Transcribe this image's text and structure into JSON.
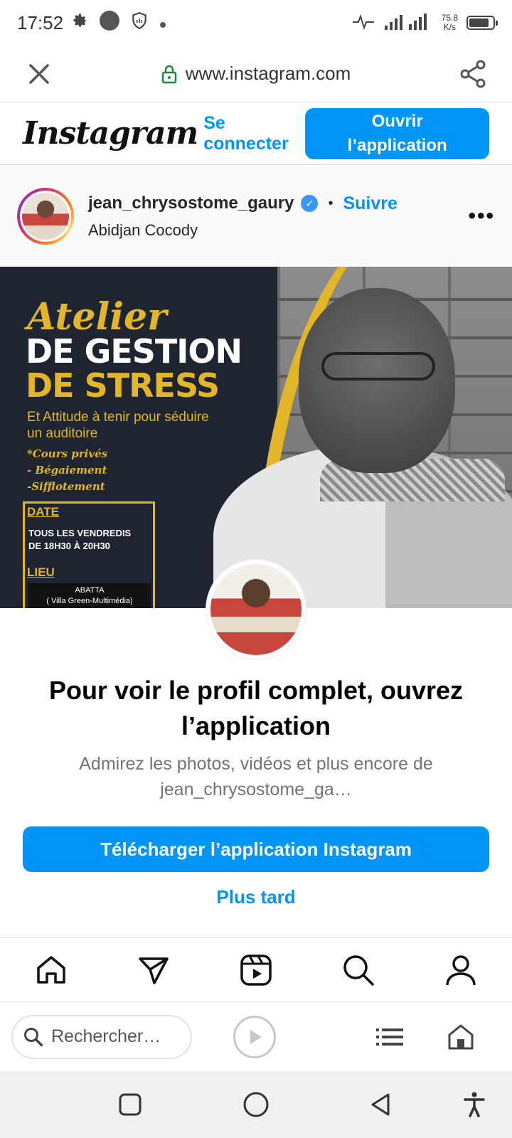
{
  "status_bar": {
    "time": "17:52",
    "net_speed_value": "75.8",
    "net_speed_unit": "K/s",
    "network_type": "4G",
    "battery_level": 0.75,
    "icons": [
      "settings-icon",
      "circle-notification-icon",
      "shield-icon",
      "dot-icon",
      "activity-icon",
      "signal-icon",
      "battery-icon"
    ]
  },
  "browser": {
    "url": "www.instagram.com",
    "search_placeholder": "Rechercher…"
  },
  "ig_header": {
    "logo": "Instagram",
    "login_label": "Se connecter",
    "open_app_label": "Ouvrir l’application"
  },
  "post": {
    "username": "jean_chrysostome_gaury",
    "separator": "•",
    "follow_label": "Suivre",
    "location": "Abidjan Cocody",
    "more_label": "•••",
    "flyer": {
      "atelier": "Atelier",
      "line1": "DE GESTION",
      "line2": "DE STRESS",
      "subtitle": "Et Attitude à tenir pour séduire un auditoire",
      "course1": "*Cours privés",
      "course2": "- Bégaiement",
      "course3": "-Sifflotement",
      "date_label": "DATE",
      "date_line1": "TOUS LES VENDREDIS",
      "date_line2": "DE 18H30 À 20H30",
      "lieu_label": "LIEU",
      "lieu_line1": "ABATTA",
      "lieu_line2": "( Villa Green-Multimédia)"
    }
  },
  "sheet": {
    "title": "Pour voir le profil complet, ouvrez l’application",
    "desc_line1": "Admirez les photos, vidéos et plus encore de",
    "desc_line2": "jean_chrysostome_ga…",
    "download_label": "Télécharger l’application Instagram",
    "later_label": "Plus tard"
  },
  "colors": {
    "ig_blue": "#0095f6",
    "flyer_gold": "#e2b628",
    "flyer_navy": "#1e2530"
  }
}
